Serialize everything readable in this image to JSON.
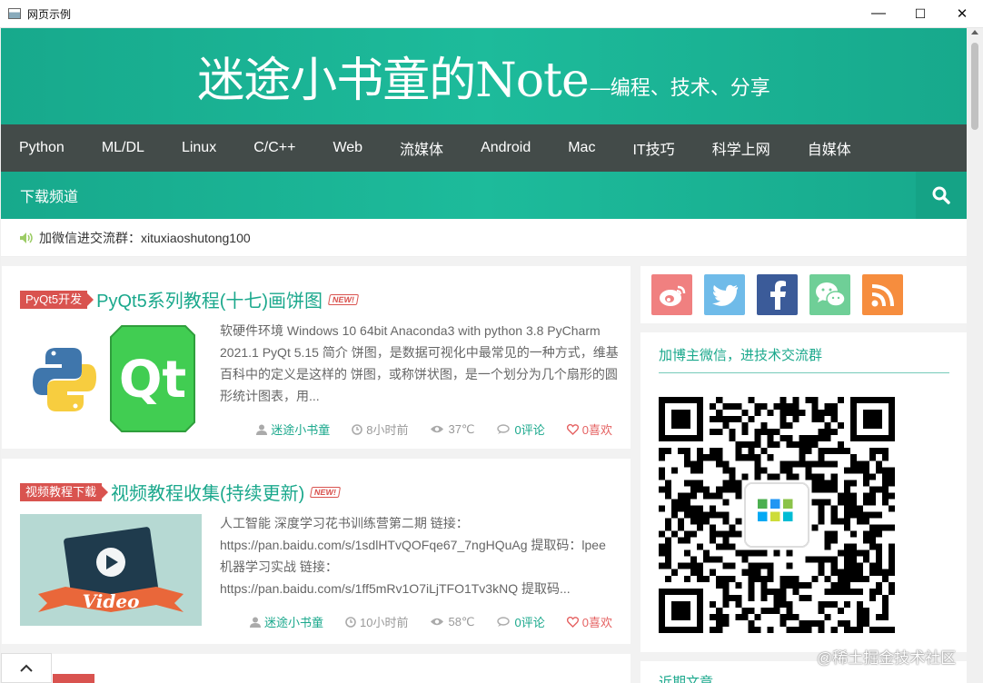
{
  "window": {
    "title": "网页示例",
    "minimize": "—",
    "maximize": "☐",
    "close": "✕"
  },
  "header": {
    "title": "迷途小书童的Note",
    "subtitle": "—编程、技术、分享"
  },
  "nav": {
    "items": [
      "Python",
      "ML/DL",
      "Linux",
      "C/C++",
      "Web",
      "流媒体",
      "Android",
      "Mac",
      "IT技巧",
      "科学上网",
      "自媒体"
    ]
  },
  "subnav": {
    "download": "下载频道"
  },
  "notice": {
    "text": "加微信进交流群：xituxiaoshutong100"
  },
  "posts": [
    {
      "category": "PyQt5开发",
      "title": "PyQt5系列教程(十七)画饼图",
      "new": "NEW!",
      "excerpt": "软硬件环境 Windows 10 64bit Anaconda3 with python 3.8 PyCharm 2021.1 PyQt 5.15 简介 饼图，是数据可视化中最常见的一种方式，维基百科中的定义是这样的 饼图，或称饼状图，是一个划分为几个扇形的圆形统计图表，用...",
      "author": "迷途小书童",
      "time": "8小时前",
      "views": "37℃",
      "comments": "0评论",
      "likes": "0喜欢"
    },
    {
      "category": "视频教程下载",
      "title": "视频教程收集(持续更新)",
      "new": "NEW!",
      "excerpt": "人工智能 深度学习花书训练营第二期 链接：https://pan.baidu.com/s/1sdlHTvQOFqe67_7ngHQuAg 提取码：lpee 机器学习实战 链接：https://pan.baidu.com/s/1ff5mRv1O7iLjTFO1Tv3kNQ 提取码...",
      "author": "迷途小书童",
      "time": "10小时前",
      "views": "58℃",
      "comments": "0评论",
      "likes": "0喜欢"
    }
  ],
  "sidebar": {
    "wechat_heading": "加博主微信，进技术交流群",
    "recent_heading": "近期文章",
    "social": [
      "weibo-icon",
      "twitter-icon",
      "facebook-icon",
      "wechat-icon",
      "rss-icon"
    ]
  },
  "watermark": "@稀土掘金技术社区",
  "colors": {
    "accent": "#1dbb9b",
    "nav_bg": "#434b49",
    "badge": "#d9534f"
  }
}
